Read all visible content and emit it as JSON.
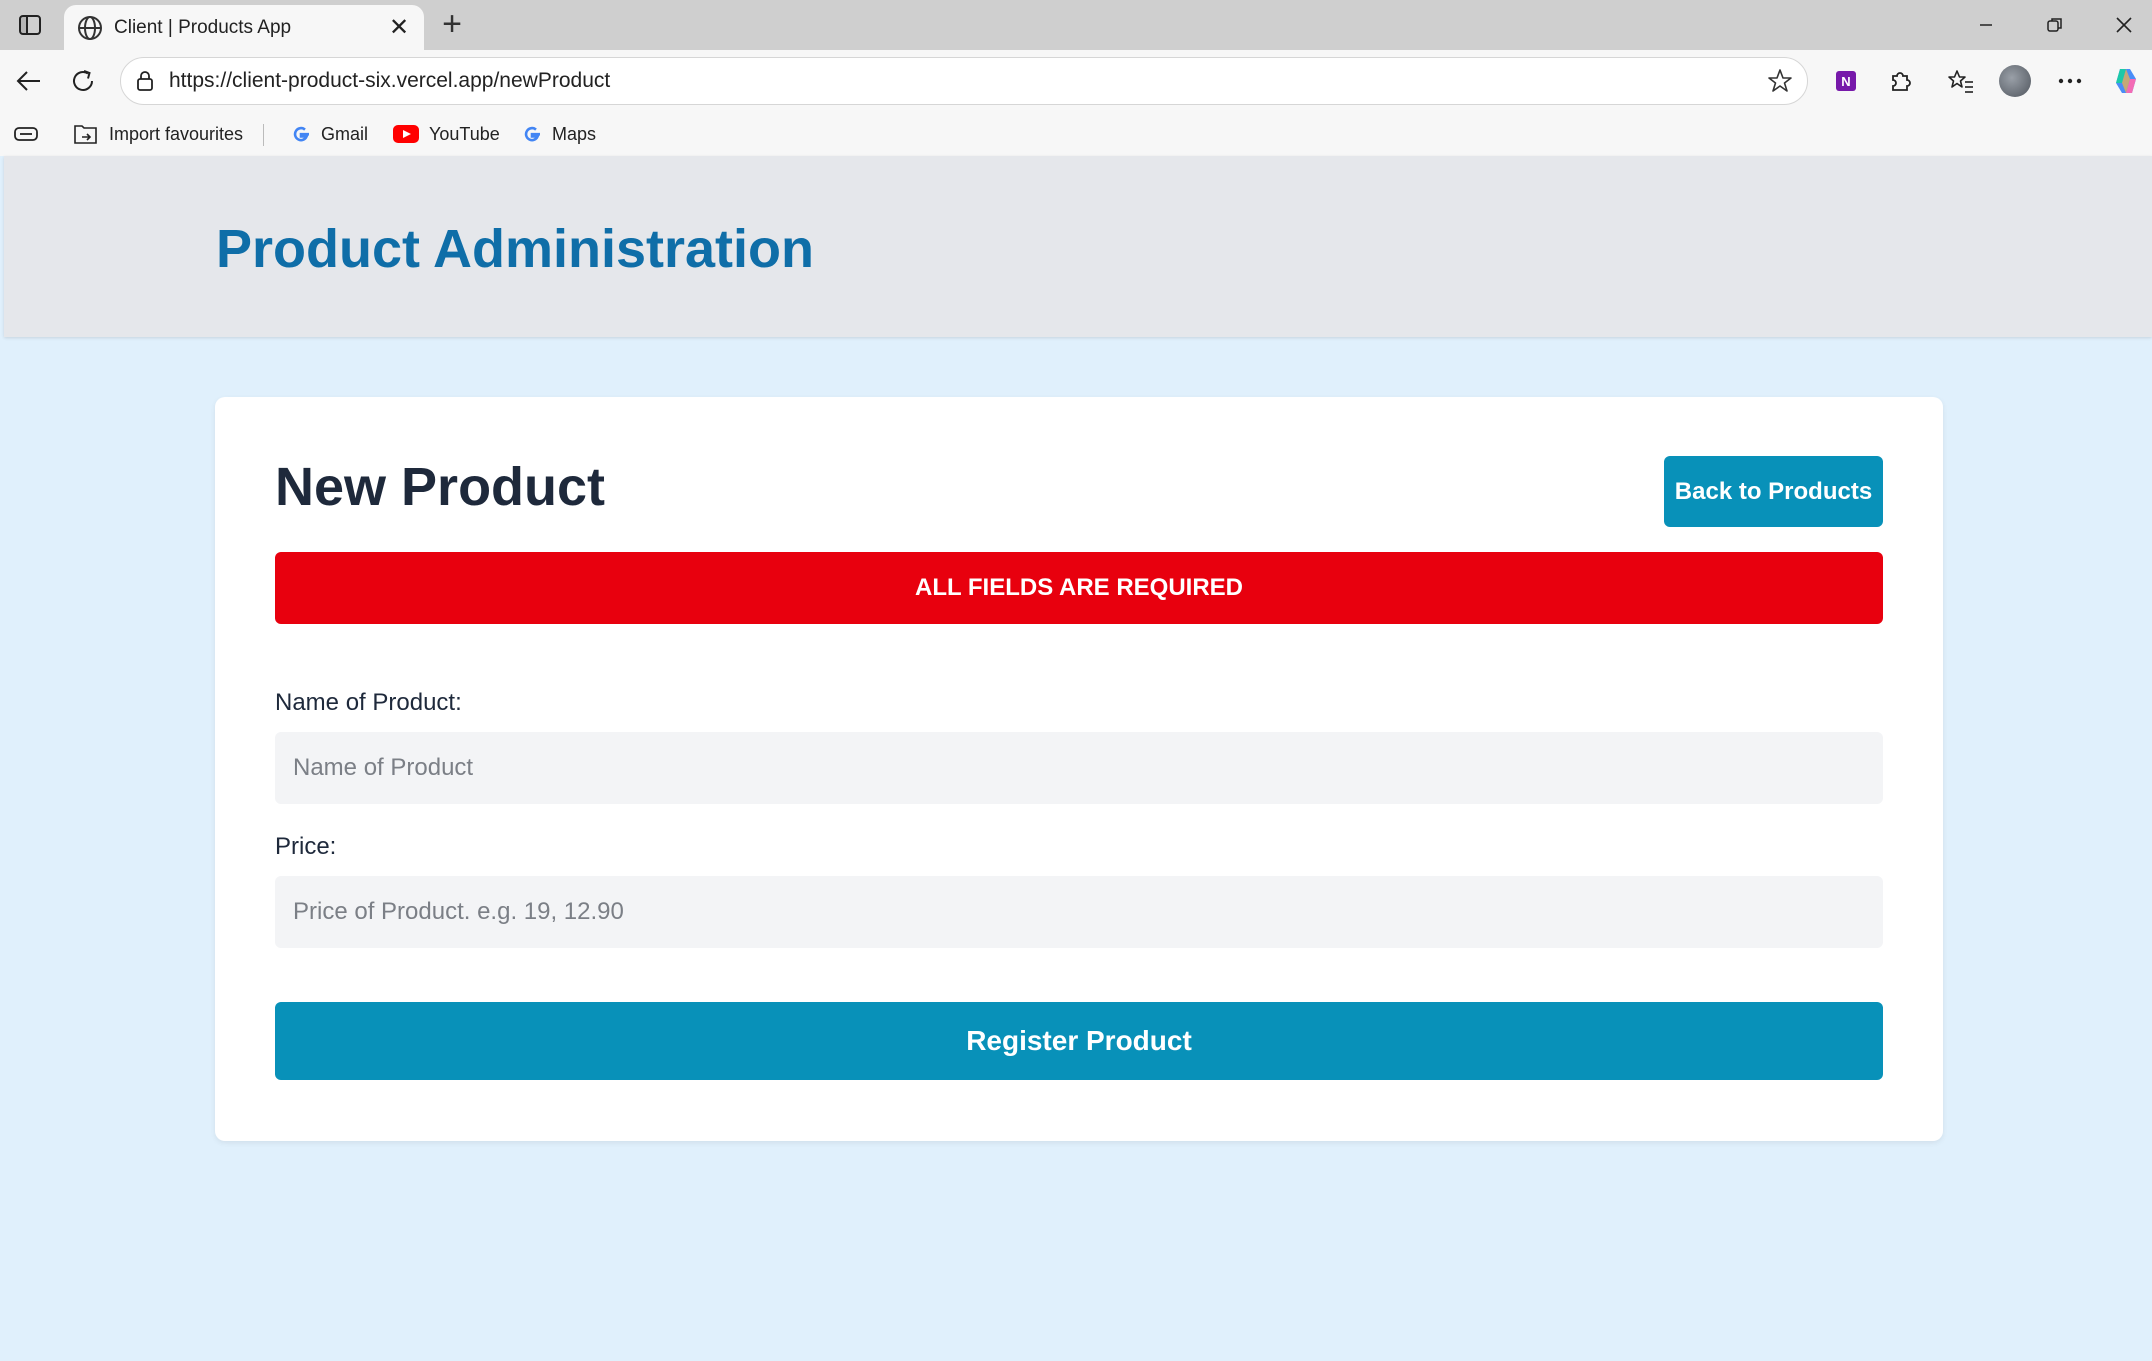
{
  "browser": {
    "tab_title": "Client | Products App",
    "url": "https://client-product-six.vercel.app/newProduct",
    "bookmarks": [
      {
        "label": "Import favourites",
        "icon": "import-icon"
      },
      {
        "label": "Gmail",
        "icon": "google-icon"
      },
      {
        "label": "YouTube",
        "icon": "youtube-icon"
      },
      {
        "label": "Maps",
        "icon": "google-icon"
      }
    ]
  },
  "header": {
    "title": "Product Administration"
  },
  "form": {
    "title": "New Product",
    "back_label": "Back to Products",
    "alert": "ALL FIELDS ARE REQUIRED",
    "name_label": "Name of Product:",
    "name_placeholder": "Name of Product",
    "name_value": "",
    "price_label": "Price:",
    "price_placeholder": "Price of Product. e.g. 19, 12.90",
    "price_value": "",
    "submit_label": "Register Product"
  },
  "colors": {
    "header_title": "#0f6ea8",
    "button": "#0891b9",
    "alert": "#e8000e",
    "page_bg": "#e0f0fc"
  }
}
